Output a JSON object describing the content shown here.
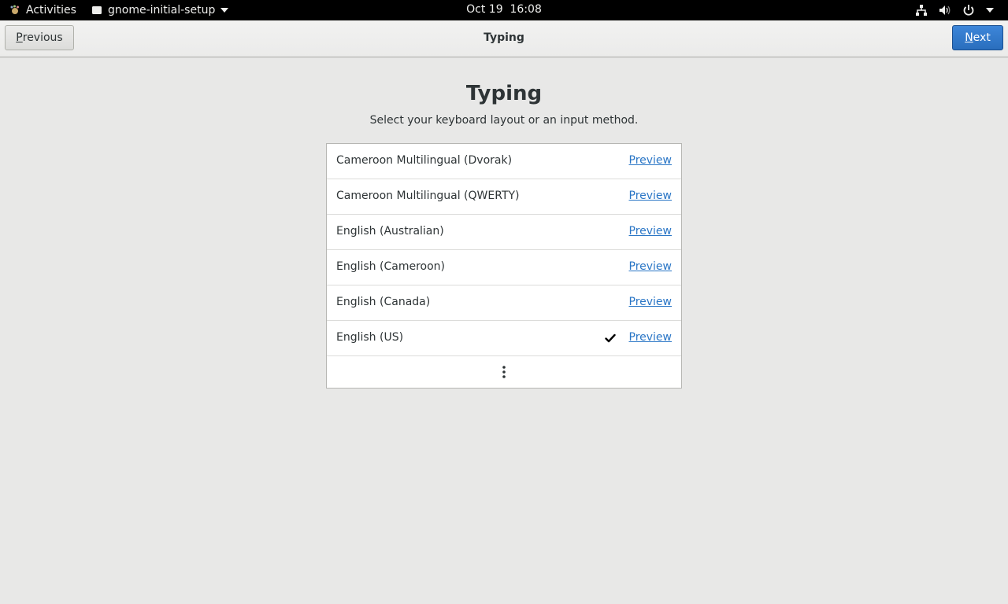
{
  "topbar": {
    "activities_label": "Activities",
    "app_name": "gnome-initial-setup",
    "datetime": "Oct 19  16:08",
    "icons": [
      "network-icon",
      "volume-icon",
      "power-icon",
      "chevron-down-icon"
    ]
  },
  "headerbar": {
    "title": "Typing",
    "previous_mnemonic": "P",
    "previous_rest": "revious",
    "next_mnemonic": "N",
    "next_rest": "ext"
  },
  "main": {
    "heading": "Typing",
    "subtitle": "Select your keyboard layout or an input method.",
    "layouts": [
      {
        "name": "Cameroon Multilingual (Dvorak)",
        "preview": "Preview",
        "selected": false
      },
      {
        "name": "Cameroon Multilingual (QWERTY)",
        "preview": "Preview",
        "selected": false
      },
      {
        "name": "English (Australian)",
        "preview": "Preview",
        "selected": false
      },
      {
        "name": "English (Cameroon)",
        "preview": "Preview",
        "selected": false
      },
      {
        "name": "English (Canada)",
        "preview": "Preview",
        "selected": false
      },
      {
        "name": "English (US)",
        "preview": "Preview",
        "selected": true
      }
    ],
    "more_icon": "view-more-icon"
  },
  "colors": {
    "accent": "#2a6ebd",
    "link": "#2a76c6",
    "background": "#e8e8e7"
  }
}
